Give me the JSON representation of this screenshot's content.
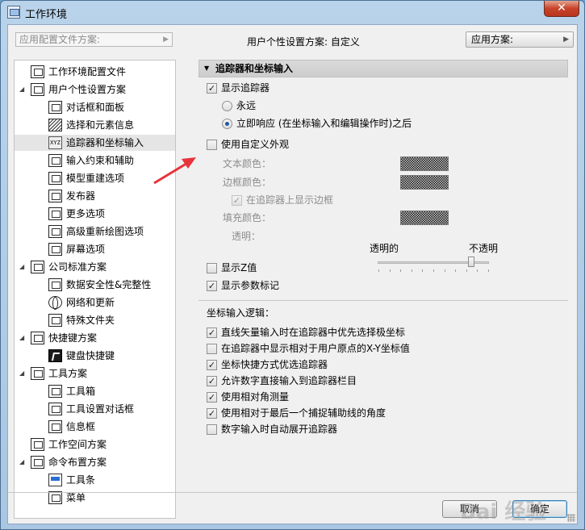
{
  "window": {
    "title": "工作环境",
    "close_label": "✕"
  },
  "topbar": {
    "scheme_placeholder": "应用配置文件方案:",
    "user_scheme_label": "用户个性设置方案:  自定义",
    "apply_label": "应用方案:"
  },
  "tree": [
    {
      "label": "工作环境配置文件",
      "level": 0,
      "icon": "profile-icon"
    },
    {
      "label": "用户个性设置方案",
      "level": 0,
      "icon": "user-settings-icon",
      "expanded": true
    },
    {
      "label": "对话框和面板",
      "level": 1,
      "icon": "dialog-panel-icon"
    },
    {
      "label": "选择和元素信息",
      "level": 1,
      "icon": "selection-info-icon"
    },
    {
      "label": "追踪器和坐标输入",
      "level": 1,
      "icon": "xyz-icon",
      "selected": true
    },
    {
      "label": "输入约束和辅助",
      "level": 1,
      "icon": "cursor-icon"
    },
    {
      "label": "模型重建选项",
      "level": 1,
      "icon": "model-rebuild-icon"
    },
    {
      "label": "发布器",
      "level": 1,
      "icon": "publisher-icon"
    },
    {
      "label": "更多选项",
      "level": 1,
      "icon": "sliders-icon"
    },
    {
      "label": "高级重新绘图选项",
      "level": 1,
      "icon": "redraw-icon"
    },
    {
      "label": "屏幕选项",
      "level": 1,
      "icon": "screen-icon"
    },
    {
      "label": "公司标准方案",
      "level": 0,
      "icon": "company-icon",
      "expanded": true
    },
    {
      "label": "数据安全性&完整性",
      "level": 1,
      "icon": "data-safety-icon"
    },
    {
      "label": "网络和更新",
      "level": 1,
      "icon": "globe-icon"
    },
    {
      "label": "特殊文件夹",
      "level": 1,
      "icon": "folder-icon"
    },
    {
      "label": "快捷键方案",
      "level": 0,
      "icon": "shortcut-scheme-icon",
      "expanded": true
    },
    {
      "label": "键盘快捷键",
      "level": 1,
      "icon": "keyboard-shortcut-icon"
    },
    {
      "label": "工具方案",
      "level": 0,
      "icon": "tool-scheme-icon",
      "expanded": true
    },
    {
      "label": "工具箱",
      "level": 1,
      "icon": "toolbox-icon"
    },
    {
      "label": "工具设置对话框",
      "level": 1,
      "icon": "tool-settings-icon"
    },
    {
      "label": "信息框",
      "level": 1,
      "icon": "info-box-icon"
    },
    {
      "label": "工作空间方案",
      "level": 0,
      "icon": "workspace-icon"
    },
    {
      "label": "命令布置方案",
      "level": 0,
      "icon": "command-layout-icon",
      "expanded": true
    },
    {
      "label": "工具条",
      "level": 1,
      "icon": "toolbar-icon"
    },
    {
      "label": "菜单",
      "level": 1,
      "icon": "menu-icon"
    }
  ],
  "panel": {
    "header": "追踪器和坐标输入",
    "show_tracker": "显示追踪器",
    "radio_always": "永远",
    "radio_immediate": "立即响应 (在坐标输入和编辑操作时)之后",
    "custom_appearance": "使用自定义外观",
    "text_color": "文本颜色：",
    "border_color": "边框颜色：",
    "show_border": "在追踪器上显示边框",
    "fill_color": "填充颜色：",
    "transparency": "透明：",
    "transparent": "透明的",
    "opaque": "不透明",
    "transparency_level": 0.85,
    "show_z": "显示Z值",
    "show_param": "显示参数标记",
    "coord_logic": "坐标输入逻辑：",
    "options": [
      {
        "label": "直线矢量输入时在追踪器中优先选择极坐标",
        "checked": true
      },
      {
        "label": "在追踪器中显示相对于用户原点的X-Y坐标值",
        "checked": false
      },
      {
        "label": "坐标快捷方式优选追踪器",
        "checked": true
      },
      {
        "label": "允许数字直接输入到追踪器栏目",
        "checked": true
      },
      {
        "label": "使用相对角测量",
        "checked": true
      },
      {
        "label": "使用相对于最后一个捕捉辅助线的角度",
        "checked": true
      },
      {
        "label": "数字输入时自动展开追踪器",
        "checked": false
      }
    ]
  },
  "buttons": {
    "cancel": "取消",
    "ok": "确定"
  },
  "watermark": "Bai 经验",
  "colors": {
    "arrow": "#e8333a",
    "selection": "#e5e5e5"
  }
}
